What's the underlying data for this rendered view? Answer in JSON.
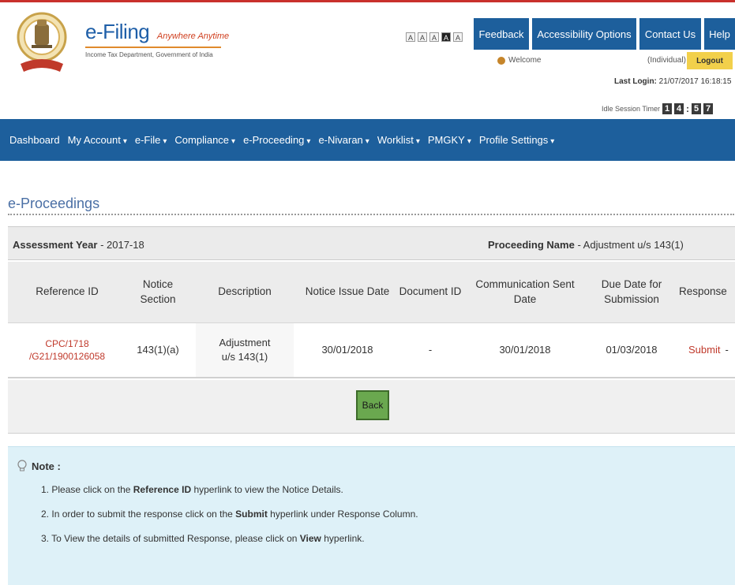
{
  "header": {
    "brand_main": "e-Filing",
    "brand_tag": "Anywhere Anytime",
    "brand_sub": "Income Tax Department, Government of India",
    "font_controls": [
      "A",
      "A",
      "A",
      "A",
      "A"
    ],
    "buttons": {
      "feedback": "Feedback",
      "accessibility": "Accessibility Options",
      "contact": "Contact Us",
      "help": "Help"
    },
    "welcome": "Welcome",
    "role": "(Individual)",
    "logout": "Logout",
    "last_login_label": "Last Login:",
    "last_login_value": "21/07/2017 16:18:15",
    "idle_label": "Idle Session Timer",
    "idle_digits": [
      "1",
      "4",
      "5",
      "7"
    ],
    "idle_colon": ":"
  },
  "nav": {
    "items": [
      {
        "label": "Dashboard",
        "caret": ""
      },
      {
        "label": "My Account",
        "caret": "▾"
      },
      {
        "label": "e-File",
        "caret": "▾"
      },
      {
        "label": "Compliance",
        "caret": "▾"
      },
      {
        "label": "e-Proceeding",
        "caret": "▾"
      },
      {
        "label": "e-Nivaran",
        "caret": "▾"
      },
      {
        "label": "Worklist",
        "caret": "▾"
      },
      {
        "label": "PMGKY",
        "caret": "▾"
      },
      {
        "label": "Profile Settings",
        "caret": "▾"
      }
    ]
  },
  "page": {
    "title": "e-Proceedings",
    "ay_label": "Assessment Year",
    "ay_value": " - 2017-18",
    "pn_label": "Proceeding Name",
    "pn_value": " - Adjustment u/s 143(1)"
  },
  "table": {
    "headers": [
      "Reference ID",
      "Notice Section",
      "Description",
      "Notice Issue Date",
      "Document ID",
      "Communication Sent Date",
      "Due Date for Submission",
      "Response"
    ],
    "row": {
      "ref_line1": "CPC/1718",
      "ref_line2": "/G21/1900126058",
      "section": "143(1)(a)",
      "desc_line1": "Adjustment",
      "desc_line2": "u/s 143(1)",
      "issue_date": "30/01/2018",
      "doc_id": "-",
      "sent_date": "30/01/2018",
      "due_date": "01/03/2018",
      "response": "Submit",
      "response_tail": "-"
    },
    "back": "Back"
  },
  "note": {
    "title": "Note :",
    "items": [
      {
        "num": "1.",
        "pre": "Please click on the ",
        "bold": "Reference ID",
        "post": " hyperlink to view the Notice Details."
      },
      {
        "num": "2.",
        "pre": "In order to submit the response click on the ",
        "bold": "Submit",
        "post": " hyperlink under Response Column."
      },
      {
        "num": "3.",
        "pre": "To View the details of submitted Response, please click on ",
        "bold": "View",
        "post": " hyperlink."
      }
    ]
  },
  "colors": {
    "brand_blue": "#1d5f9c",
    "link_red": "#c0392b",
    "logout_yellow": "#f2d04b",
    "note_bg": "#def1f8",
    "back_green": "#6aa84f"
  },
  "icons": [
    "emblem-icon",
    "user-icon",
    "bulb-icon",
    "caret-down-icon"
  ]
}
